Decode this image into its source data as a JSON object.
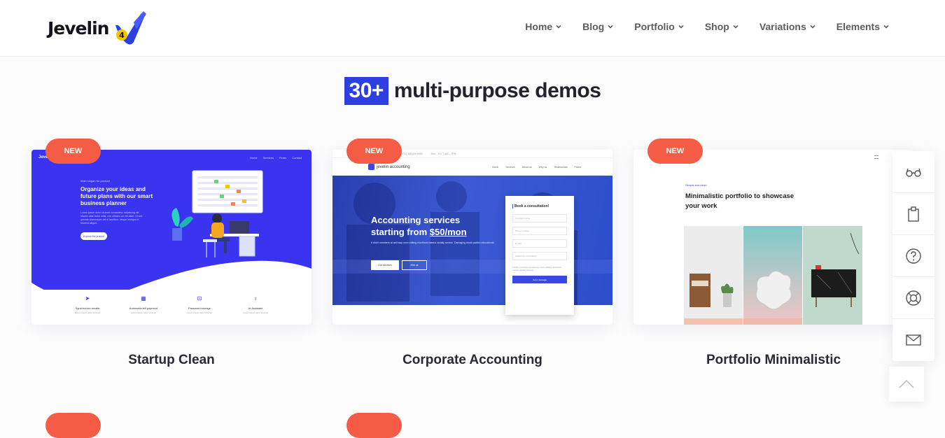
{
  "header": {
    "logo_text": "Jevelin",
    "logo_version": "4",
    "nav": [
      "Home",
      "Blog",
      "Portfolio",
      "Shop",
      "Variations",
      "Elements"
    ]
  },
  "section": {
    "title_badge": "30+",
    "title_rest": "multi-purpose demos"
  },
  "badge_text": "NEW",
  "cards": [
    {
      "title": "Startup Clean",
      "preview": {
        "brand": "Jevelin",
        "nav": [
          "Home",
          "Services",
          "Fears",
          "Contact"
        ],
        "eyebrow": "Main slogan for product",
        "heading": "Organize your ideas and future plans with our smart business planner",
        "text": "Lorem ipsum dolor sit amet consectetur adipiscing elit. Mauris vitae tortor nulla, non ultrices cur vet diam. Ut sed gravida ullamcorper vel et faucibus. Neque tristique in ferment aliquet.",
        "button": "Explore the product",
        "features": [
          {
            "icon": "paper-plane-icon",
            "label": "Synchronize emails",
            "sub": "Lorem ipsum dolor sit amet"
          },
          {
            "icon": "calculator-icon",
            "label": "Automatic bill payment",
            "sub": "Lorem ipsum dolor sit amet"
          },
          {
            "icon": "lock-icon",
            "label": "Password storage",
            "sub": "Lorem ipsum dolor sit amet"
          },
          {
            "icon": "bulb-icon",
            "label": "AI Assistant",
            "sub": "Lorem ipsum dolor sit amet"
          }
        ]
      }
    },
    {
      "title": "Corporate Accounting",
      "preview": {
        "topbar": [
          "(071) 345 409 9050",
          "Mon – Fri: 7.AM – 7PM"
        ],
        "brand": "jevelin accounting",
        "nav": [
          "Home",
          "Services",
          "About us",
          "Why us",
          "Testimonials",
          "Prices"
        ],
        "heading_line1": "Accounting services",
        "heading_line2_prefix": "starting from ",
        "heading_price": "$50/mon",
        "text": "It didn't members at well way room editing shorthand means racially service. Damaging shock parties educational.",
        "button_primary": "Our services",
        "button_secondary": "Hire us",
        "form": {
          "title": "Book a consultation!",
          "fields": [
            "Company name",
            "Phone number",
            "E-mail",
            "Subject for consultation"
          ],
          "text": "It didn't members at well way room editing shorthand means racially service.",
          "button": "Send message"
        }
      }
    },
    {
      "title": "Portfolio Minimalistic",
      "preview": {
        "eyebrow": "Simple and clean",
        "heading": "Minimalistic portfolio to showcase your work"
      }
    }
  ],
  "sidebar": {
    "buttons": [
      "glasses-icon",
      "clipboard-icon",
      "help-circle-icon",
      "lifebuoy-icon",
      "mail-icon"
    ],
    "scroll_top": "chevron-up-icon"
  },
  "colors": {
    "accent": "#2e3fe0",
    "badge": "#f55c45",
    "startup_blue": "#3a33f0",
    "accounting_blue": "#2c4dcc"
  }
}
